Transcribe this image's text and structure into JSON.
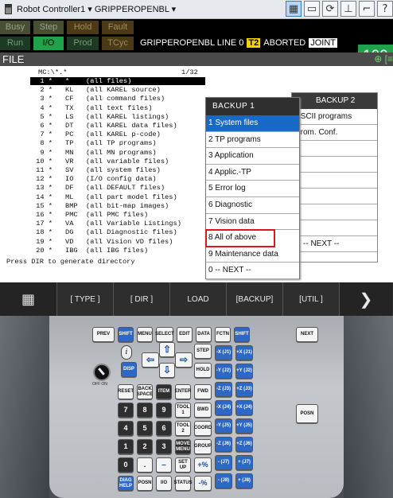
{
  "topbar": {
    "title": "Robot Controller1 ▾  GRIPPEROPENBL ▾"
  },
  "status": {
    "busy": "Busy",
    "step": "Step",
    "hold": "Hold",
    "fault": "Fault",
    "run": "Run",
    "io": "I/O",
    "prod": "Prod",
    "tcyc": "TCyc",
    "message": "GRIPPEROPENBL LINE 0",
    "t2": "T2",
    "aborted": "ABORTED",
    "joint": "JOINT",
    "override": "100",
    "override_unit": "%"
  },
  "file_header": {
    "title": "FILE",
    "icons": "⊕ [≡"
  },
  "file_list": {
    "path": "MC:\\*.*",
    "page": "1/32",
    "rows": [
      {
        "num": "1 *",
        "ext": "*",
        "desc": "(all files)"
      },
      {
        "num": "2 *",
        "ext": "KL",
        "desc": "(all KAREL source)"
      },
      {
        "num": "3 *",
        "ext": "CF",
        "desc": "(all command files)"
      },
      {
        "num": "4 *",
        "ext": "TX",
        "desc": "(all text files)"
      },
      {
        "num": "5 *",
        "ext": "LS",
        "desc": "(all KAREL listings)"
      },
      {
        "num": "6 *",
        "ext": "DT",
        "desc": "(all KAREL data files)"
      },
      {
        "num": "7 *",
        "ext": "PC",
        "desc": "(all KAREL p-code)"
      },
      {
        "num": "8 *",
        "ext": "TP",
        "desc": "(all TP programs)"
      },
      {
        "num": "9 *",
        "ext": "MN",
        "desc": "(all MN programs)"
      },
      {
        "num": "10 *",
        "ext": "VR",
        "desc": "(all variable files)"
      },
      {
        "num": "11 *",
        "ext": "SV",
        "desc": "(all system files)"
      },
      {
        "num": "12 *",
        "ext": "IO",
        "desc": "(I/O config data)"
      },
      {
        "num": "13 *",
        "ext": "DF",
        "desc": "(all DEFAULT files)"
      },
      {
        "num": "14 *",
        "ext": "ML",
        "desc": "(all part model files)"
      },
      {
        "num": "15 *",
        "ext": "BMP",
        "desc": "(all bit-map images)"
      },
      {
        "num": "16 *",
        "ext": "PMC",
        "desc": "(all PMC files)"
      },
      {
        "num": "17 *",
        "ext": "VA",
        "desc": "(all Variable Listings)"
      },
      {
        "num": "18 *",
        "ext": "DG",
        "desc": "(all Diagnostic files)"
      },
      {
        "num": "19 *",
        "ext": "VD",
        "desc": "(all Vision VD files)"
      },
      {
        "num": "20 *",
        "ext": "IBG",
        "desc": "(all IBG files)"
      }
    ],
    "footer": "Press DIR to generate directory"
  },
  "backup1": {
    "title": "BACKUP  1",
    "items": [
      "1 System files",
      "2 TP programs",
      "3 Application",
      "4 Applic.-TP",
      "5 Error log",
      "6 Diagnostic",
      "7 Vision data",
      "8 All of above",
      "9 Maintenance data",
      "0 -- NEXT --"
    ]
  },
  "backup2": {
    "title": "BACKUP  2",
    "items": [
      "ASCII programs",
      "Prom. Conf.",
      "",
      "",
      "",
      "",
      "",
      "",
      "-- NEXT --"
    ]
  },
  "softkeys": {
    "type": "[ TYPE ]",
    "dir": "[ DIR ]",
    "load": "LOAD",
    "backup": "[BACKUP]",
    "util": "[UTIL ]",
    "next": "❯"
  },
  "pendant": {
    "prev": "PREV",
    "shift": "SHIFT",
    "menu": "MENU",
    "select": "SELECT",
    "edit": "EDIT",
    "data": "DATA",
    "fctn": "FCTN",
    "next": "NEXT",
    "info": "i",
    "disp": "DISP",
    "step": "STEP",
    "hold": "HOLD",
    "reset": "RESET",
    "backspace": "BACK SPACE",
    "item": "ITEM",
    "enter": "ENTER",
    "fwd": "FWD",
    "bwd": "BWD",
    "tool1": "TOOL 1",
    "tool2": "TOOL 2",
    "coord": "COORD",
    "move_menu": "MOVE MENU",
    "group": "GROUP",
    "set_up": "SET UP",
    "diag_help": "DIAG HELP",
    "posn": "POSN",
    "io": "I/O",
    "status": "STATUS",
    "dial_label": "OFF  ON",
    "digits": [
      "7",
      "8",
      "9",
      "4",
      "5",
      "6",
      "1",
      "2",
      "3",
      "0",
      "."
    ],
    "jog": [
      "-X (J1)",
      "+X (J1)",
      "-Y (J2)",
      "+Y (J2)",
      "-Z (J3)",
      "+Z (J3)",
      "-X (J4)",
      "+X (J4)",
      "-Y (J5)",
      "+Y (J5)",
      "-Z (J6)",
      "+Z (J6)",
      "- (J7)",
      "+ (J7)",
      "- (J8)",
      "+ (J8)"
    ]
  }
}
